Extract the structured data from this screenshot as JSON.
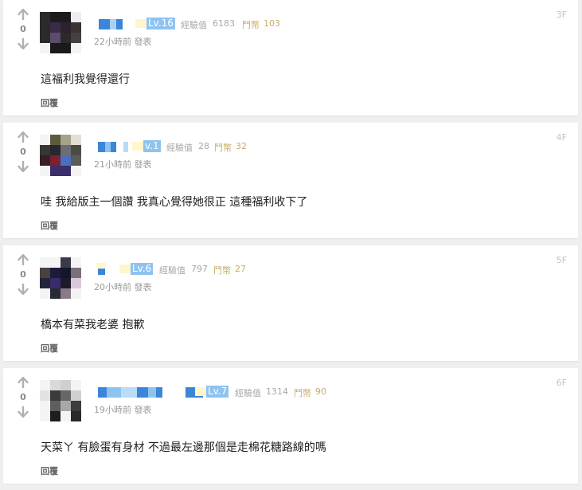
{
  "comments": [
    {
      "floor": "3F",
      "votes": "0",
      "level": "Lv.16",
      "exp_label": "經驗值",
      "exp_value": "6183",
      "coin_label": "鬥幣",
      "coin_value": "103",
      "time": "22小時前 發表",
      "content": "這福利我覺得還行",
      "reply_label": "回覆"
    },
    {
      "floor": "4F",
      "votes": "0",
      "level": "v.1",
      "exp_label": "經驗值",
      "exp_value": "28",
      "coin_label": "鬥幣",
      "coin_value": "32",
      "time": "21小時前 發表",
      "content": "哇 我給版主一個讚 我真心覺得她很正 這種福利收下了",
      "reply_label": "回覆"
    },
    {
      "floor": "5F",
      "votes": "0",
      "level": "Lv.6",
      "exp_label": "經驗值",
      "exp_value": "797",
      "coin_label": "鬥幣",
      "coin_value": "27",
      "time": "20小時前 發表",
      "content": "橋本有菜我老婆 抱歉",
      "reply_label": "回覆"
    },
    {
      "floor": "6F",
      "votes": "0",
      "level": "Lv.7",
      "exp_label": "經驗值",
      "exp_value": "1314",
      "coin_label": "鬥幣",
      "coin_value": "90",
      "time": "19小時前 發表",
      "content": "天菜ㄚ 有臉蛋有身材 不過最左邊那個是走棉花糖路線的嗎",
      "reply_label": "回覆"
    }
  ],
  "icons": {
    "upvote": "up-arrow-icon",
    "downvote": "down-arrow-icon"
  },
  "colors": {
    "level_badge": "#8ec3f0",
    "exp_text": "#a8a8a8",
    "coin_text": "#c7ac6a",
    "floor_text": "#c4c4c4",
    "page_bg": "#efefef"
  }
}
